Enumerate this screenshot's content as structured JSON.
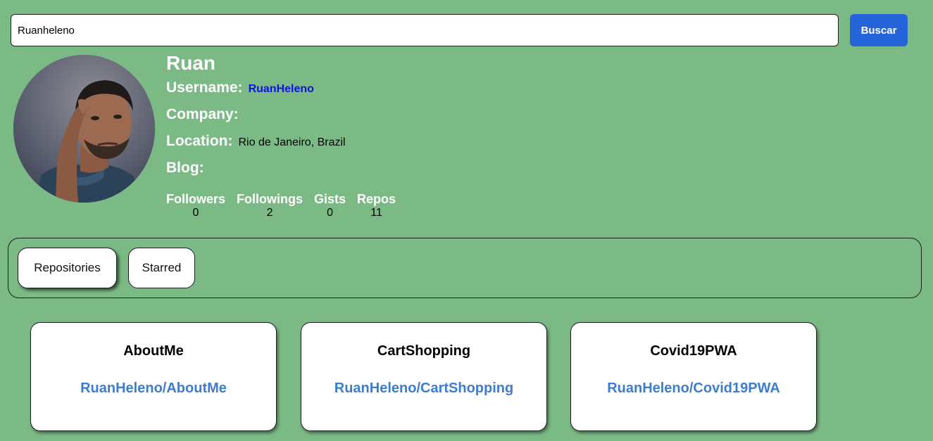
{
  "search": {
    "value": "Ruanheleno",
    "button_label": "Buscar"
  },
  "profile": {
    "name": "Ruan",
    "username_label": "Username:",
    "username": "RuanHeleno",
    "company_label": "Company:",
    "company": "",
    "location_label": "Location:",
    "location": "Rio de Janeiro, Brazil",
    "blog_label": "Blog:",
    "blog": ""
  },
  "stats": [
    {
      "label": "Followers",
      "value": "0"
    },
    {
      "label": "Followings",
      "value": "2"
    },
    {
      "label": "Gists",
      "value": "0"
    },
    {
      "label": "Repos",
      "value": "11"
    }
  ],
  "tabs": [
    {
      "label": "Repositories",
      "active": true
    },
    {
      "label": "Starred",
      "active": false
    }
  ],
  "repos": [
    {
      "name": "AboutMe",
      "full_name": "RuanHeleno/AboutMe"
    },
    {
      "name": "CartShopping",
      "full_name": "RuanHeleno/CartShopping"
    },
    {
      "name": "Covid19PWA",
      "full_name": "RuanHeleno/Covid19PWA"
    }
  ],
  "colors": {
    "background": "#7bba85",
    "accent": "#2664d9",
    "repo_link": "#3d7ecb",
    "username_link": "#0d10e8"
  }
}
